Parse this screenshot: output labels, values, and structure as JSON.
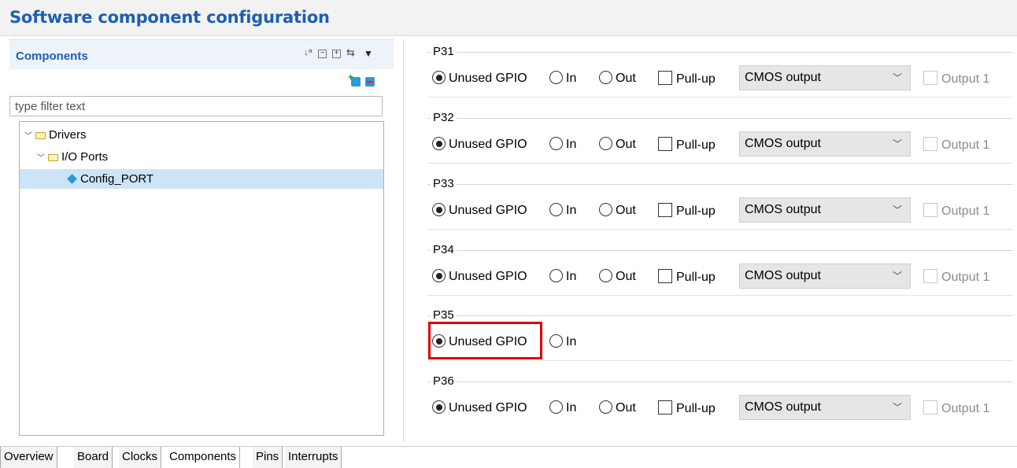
{
  "page": {
    "title": "Software component configuration"
  },
  "components": {
    "title": "Components",
    "filter_placeholder": "type filter text",
    "tree": [
      {
        "label": "Drivers"
      },
      {
        "label": "I/O Ports"
      },
      {
        "label": "Config_PORT"
      }
    ]
  },
  "ports": [
    {
      "label": "P31",
      "unused": "Unused GPIO",
      "in": "In",
      "out": "Out",
      "pullup": "Pull-up",
      "output_type": "CMOS output",
      "output1": "Output 1"
    },
    {
      "label": "P32",
      "unused": "Unused GPIO",
      "in": "In",
      "out": "Out",
      "pullup": "Pull-up",
      "output_type": "CMOS output",
      "output1": "Output 1"
    },
    {
      "label": "P33",
      "unused": "Unused GPIO",
      "in": "In",
      "out": "Out",
      "pullup": "Pull-up",
      "output_type": "CMOS output",
      "output1": "Output 1"
    },
    {
      "label": "P34",
      "unused": "Unused GPIO",
      "in": "In",
      "out": "Out",
      "pullup": "Pull-up",
      "output_type": "CMOS output",
      "output1": "Output 1"
    },
    {
      "label": "P35",
      "unused": "Unused GPIO",
      "in": "In"
    },
    {
      "label": "P36",
      "unused": "Unused GPIO",
      "in": "In",
      "out": "Out",
      "pullup": "Pull-up",
      "output_type": "CMOS output",
      "output1": "Output 1"
    }
  ],
  "bottom_tabs": [
    "Overview",
    "Board",
    "Clocks",
    "Components",
    "Pins",
    "Interrupts"
  ],
  "active_tab": "Components",
  "colors": {
    "title": "#1d5fb3",
    "selection": "#cce4f7",
    "highlight": "#e00000"
  }
}
